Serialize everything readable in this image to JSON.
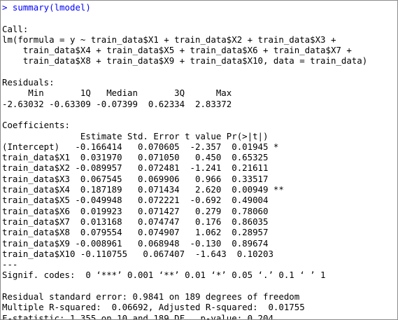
{
  "console": {
    "prompt": "> ",
    "command": "summary(lmodel)",
    "call_header": "Call:",
    "call_lines": [
      "lm(formula = y ~ train_data$X1 + train_data$X2 + train_data$X3 +",
      "    train_data$X4 + train_data$X5 + train_data$X6 + train_data$X7 +",
      "    train_data$X8 + train_data$X9 + train_data$X10, data = train_data)"
    ],
    "residuals_header": "Residuals:",
    "residuals_labels": "     Min       1Q   Median       3Q      Max ",
    "residuals_values": "-2.63032 -0.63309 -0.07399  0.62334  2.83372 ",
    "coefficients_header": "Coefficients:",
    "coefficients_columns": "               Estimate Std. Error t value Pr(>|t|)   ",
    "coefficients_rows": [
      "(Intercept)   -0.166414   0.070605  -2.357  0.01945 * ",
      "train_data$X1  0.031970   0.071050   0.450  0.65325   ",
      "train_data$X2 -0.089957   0.072481  -1.241  0.21611   ",
      "train_data$X3  0.067545   0.069906   0.966  0.33517   ",
      "train_data$X4  0.187189   0.071434   2.620  0.00949 **",
      "train_data$X5 -0.049948   0.072221  -0.692  0.49004   ",
      "train_data$X6  0.019923   0.071427   0.279  0.78060   ",
      "train_data$X7  0.013168   0.074747   0.176  0.86035   ",
      "train_data$X8  0.079554   0.074907   1.062  0.28957   ",
      "train_data$X9 -0.008961   0.068948  -0.130  0.89674   ",
      "train_data$X10 -0.110755   0.067407  -1.643  0.10203   "
    ],
    "separator": "---",
    "signif_codes": "Signif. codes:  0 ‘***’ 0.001 ‘**’ 0.01 ‘*’ 0.05 ‘.’ 0.1 ‘ ’ 1",
    "residual_se": "Residual standard error: 0.9841 on 189 degrees of freedom",
    "r_squared": "Multiple R-squared:  0.06692, Adjusted R-squared:  0.01755 ",
    "f_statistic": "F-statistic: 1.355 on 10 and 189 DF,  p-value: 0.204"
  },
  "colors": {
    "command": "#0000ff",
    "output": "#000000",
    "background": "#ffffff"
  }
}
